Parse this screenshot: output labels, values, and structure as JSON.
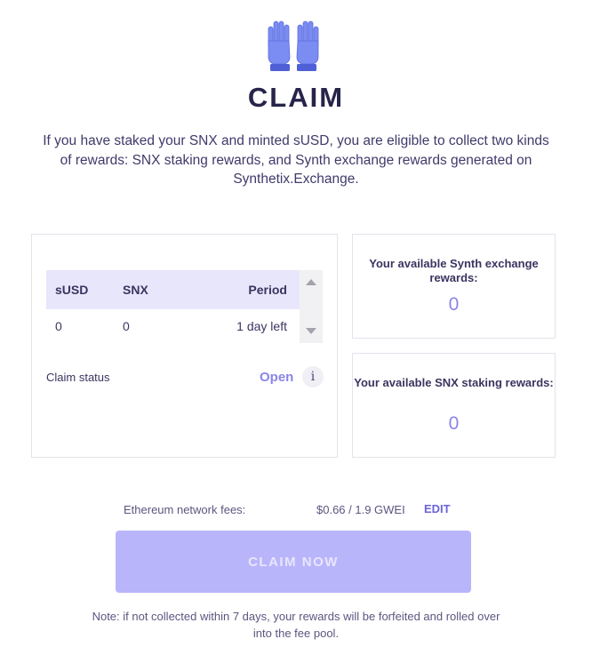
{
  "header": {
    "icon": "raised-hands-icon",
    "title": "CLAIM",
    "intro": "If you have staked your SNX and minted sUSD, you are eligible to collect two kinds of rewards: SNX staking rewards, and Synth exchange rewards generated on Synthetix.Exchange."
  },
  "table": {
    "columns": [
      "sUSD",
      "SNX",
      "Period"
    ],
    "rows": [
      {
        "susd": "0",
        "snx": "0",
        "period": "1 day left"
      }
    ]
  },
  "claim_status": {
    "label": "Claim status",
    "value": "Open",
    "info_icon_glyph": "i"
  },
  "rewards": {
    "synth": {
      "label": "Your available Synth exchange rewards:",
      "value": "0"
    },
    "snx": {
      "label": "Your available SNX staking rewards:",
      "value": "0"
    }
  },
  "fees": {
    "label": "Ethereum network fees:",
    "value": "$0.66 / 1.9 GWEI",
    "edit_label": "EDIT"
  },
  "claim_button": {
    "label": "CLAIM NOW"
  },
  "note": "Note: if not collected within 7 days, your rewards will be forfeited and rolled over into the fee pool.",
  "colors": {
    "accent": "#8a85e8",
    "button_bg": "#b9b5fb",
    "table_header_bg": "#e8e6fb",
    "hands": "#7b8cf2"
  }
}
